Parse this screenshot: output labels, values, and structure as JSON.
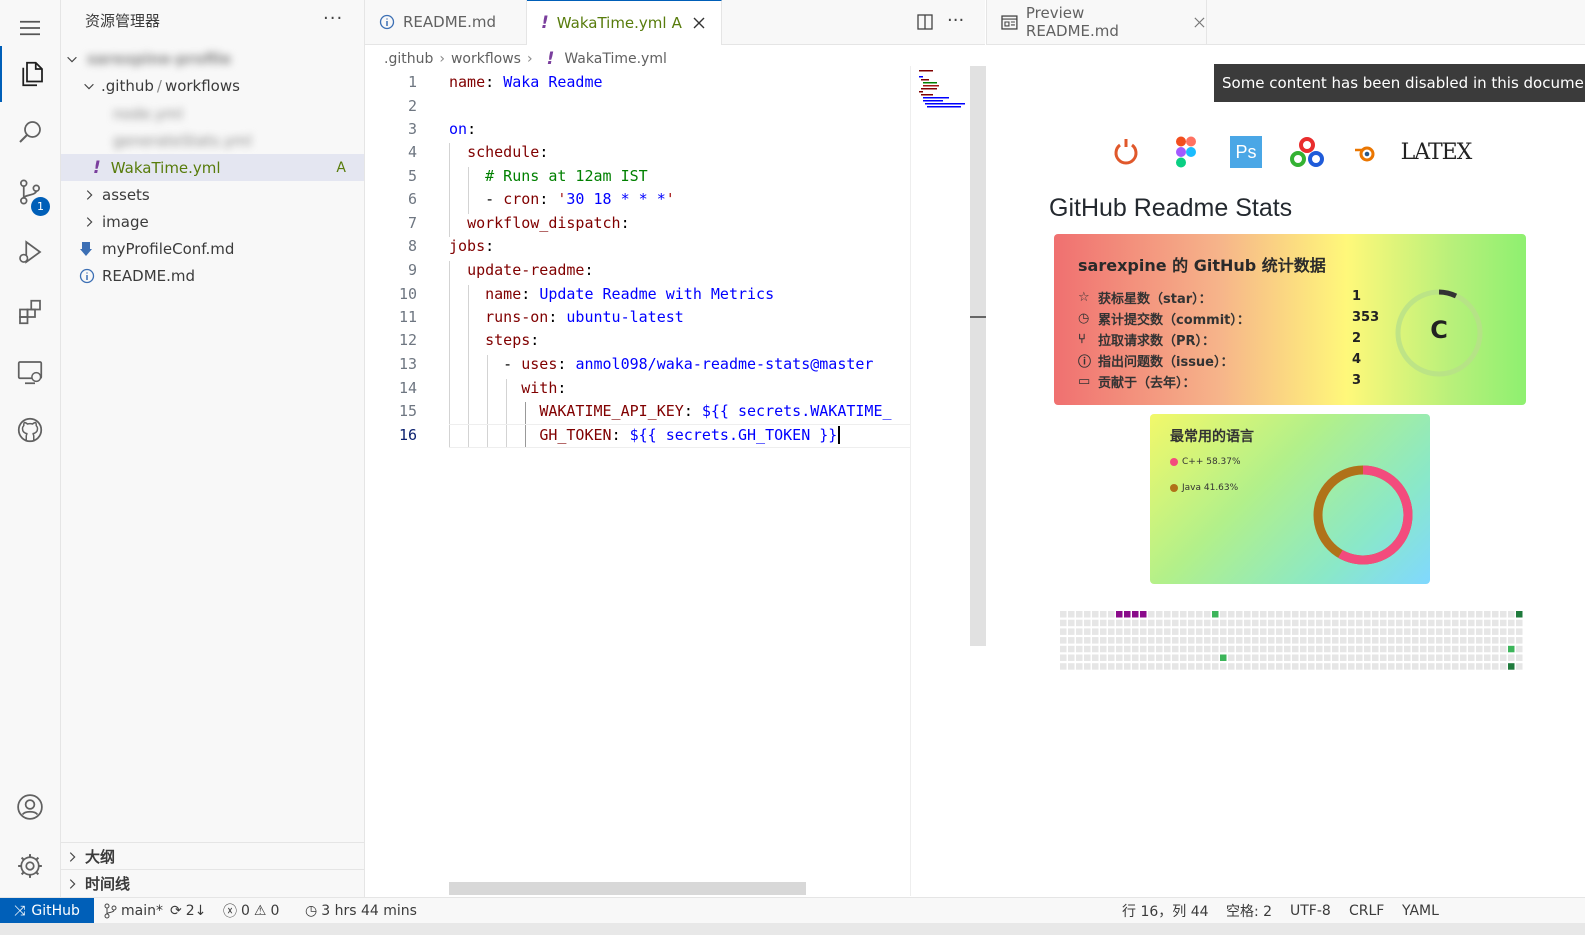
{
  "sidebar": {
    "title": "资源管理器",
    "more": "···",
    "root": "sarexpine-profile",
    "folder_github": ".github",
    "folder_sep": "/",
    "folder_workflows": "workflows",
    "blur1": "node.yml",
    "blur2": "generateStats.yml",
    "file_waka": "WakaTime.yml",
    "file_waka_status": "A",
    "folder_assets": "assets",
    "folder_image": "image",
    "file_profile": "myProfileConf.md",
    "file_readme": "README.md",
    "section_outline": "大纲",
    "section_timeline": "时间线"
  },
  "activity": {
    "scm_badge": "1"
  },
  "tabs": {
    "readme": "README.md",
    "waka": "WakaTime.yml",
    "waka_status": "A",
    "more": "···",
    "preview": "Preview README.md"
  },
  "breadcrumbs": {
    "a": ".github",
    "b": "workflows",
    "c": "WakaTime.yml"
  },
  "code": {
    "l1k": "name",
    "l1v": "Waka Readme",
    "l3k": "on",
    "l4k": "schedule",
    "l5c": "# Runs at 12am IST",
    "l6k": "cron",
    "l6q": "'",
    "l6v": "30 18 * * *",
    "l7k": "workflow_dispatch",
    "l8k": "jobs",
    "l9k": "update-readme",
    "l10k": "name",
    "l10v": "Update Readme with Metrics",
    "l11k": "runs-on",
    "l11v": "ubuntu-latest",
    "l12k": "steps",
    "l13k": "uses",
    "l13v": "anmol098/waka-readme-stats@master",
    "l14k": "with",
    "l15k": "WAKATIME_API_KEY",
    "l15v": "${{ secrets.WAKATIME_",
    "l16k": "GH_TOKEN",
    "l16v": "${{ secrets.GH_TOKEN }}"
  },
  "preview": {
    "notice": "Some content has been disabled in this document",
    "latex": "LATEX",
    "ps": "Ps",
    "heading": "GitHub Readme Stats",
    "stats_title": "sarexpine 的 GitHub 统计数据",
    "stats": [
      {
        "label": "获标星数（star）：",
        "value": "1"
      },
      {
        "label": "累计提交数（commit）：",
        "value": "353"
      },
      {
        "label": "拉取请求数（PR）：",
        "value": "2"
      },
      {
        "label": "指出问题数（issue）：",
        "value": "4"
      },
      {
        "label": "贡献于（去年）：",
        "value": "3"
      }
    ],
    "rank": "C",
    "lang_title": "最常用的语言",
    "langs": [
      {
        "name": "C++ 58.37%",
        "color": "#f34b7d"
      },
      {
        "name": "Java 41.63%",
        "color": "#b07219"
      }
    ]
  },
  "status": {
    "remote": "GitHub",
    "branch": "main*",
    "sync": "2↓",
    "errors": "0",
    "warnings": "0",
    "time": "3 hrs 44 mins",
    "position": "行 16，列 44",
    "spaces": "空格: 2",
    "encoding": "UTF-8",
    "eol": "CRLF",
    "lang": "YAML"
  },
  "colors": {
    "accent": "#005fb8",
    "key": "#800000",
    "value": "#0000ff",
    "comment": "#008000"
  }
}
